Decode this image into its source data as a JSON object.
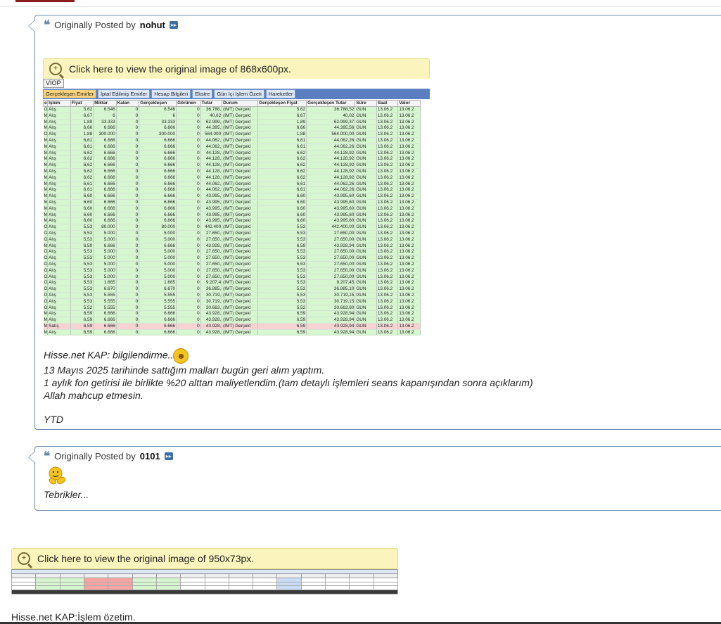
{
  "post1": {
    "quote_prefix": "Originally Posted by",
    "author": "nohut",
    "image_link": "Click here to view the original image of 868x600px.",
    "screenshot": {
      "viop_tab": "VİOP",
      "tabs": [
        "Gerçekleşen Emirler",
        "İptal Edilmiş Emirler",
        "Hesap Bilgileri",
        "Ekstre",
        "Gün İçi İşlem Özeti",
        "Hareketler"
      ],
      "columns": [
        "e",
        "İşlem",
        "Fiyat",
        "Miktar",
        "Kalan",
        "Gerçekleşen",
        "Görünen",
        "Tutar",
        "Durum",
        "Gerçekleşen Fiyat",
        "Gerçekleşen Tutar",
        "Süre",
        "Saat",
        "Valor"
      ],
      "rows": [
        [
          "O",
          "Alış",
          "5,62",
          "6.546",
          "0",
          "6.546",
          "0",
          "36.788,",
          "(İMT) Gerçekl",
          "5,62",
          "36.788,52",
          "GUN",
          "13.06.2",
          "13.06.2"
        ],
        [
          "M",
          "Alış",
          "6,67",
          "6",
          "0",
          "6",
          "0",
          "40,02",
          "(İMT) Gerçekl",
          "6,67",
          "40,02",
          "GUN",
          "13.06.2",
          "13.06.2"
        ],
        [
          "M",
          "Alış",
          "1,89",
          "33.333",
          "0",
          "33.333",
          "0",
          "62.999,",
          "(İMT) Gerçekl",
          "1,89",
          "62.999,37",
          "GUN",
          "13.06.2",
          "13.06.2"
        ],
        [
          "M",
          "Alış",
          "6,66",
          "6.666",
          "0",
          "6.666",
          "0",
          "44.395,",
          "(İMT) Gerçekl",
          "6,66",
          "44.395,56",
          "GUN",
          "13.06.2",
          "13.06.2"
        ],
        [
          "O",
          "Alış",
          "1,88",
          "300.000",
          "0",
          "300.000",
          "0",
          "564.000",
          "(İMT) Gerçekl",
          "1,88",
          "564.000,00",
          "GUN",
          "13.06.2",
          "13.06.2"
        ],
        [
          "M",
          "Alış",
          "6,61",
          "6.666",
          "0",
          "6.666",
          "0",
          "44.062,",
          "(İMT) Gerçekl",
          "6,61",
          "44.062,26",
          "GUN",
          "13.06.2",
          "13.06.2"
        ],
        [
          "M",
          "Alış",
          "6,61",
          "6.666",
          "0",
          "6.666",
          "0",
          "44.062,",
          "(İMT) Gerçekl",
          "6,61",
          "44.062,26",
          "GUN",
          "13.06.2",
          "13.06.2"
        ],
        [
          "M",
          "Alış",
          "6,62",
          "6.666",
          "0",
          "6.666",
          "0",
          "44.128,",
          "(İMT) Gerçekl",
          "6,62",
          "44.128,92",
          "GUN",
          "13.06.2",
          "13.06.2"
        ],
        [
          "M",
          "Alış",
          "6,62",
          "6.666",
          "0",
          "6.666",
          "0",
          "44.128,",
          "(İMT) Gerçekl",
          "6,62",
          "44.128,92",
          "GUN",
          "13.06.2",
          "13.06.2"
        ],
        [
          "M",
          "Alış",
          "6,62",
          "6.666",
          "0",
          "6.666",
          "0",
          "44.128,",
          "(İMT) Gerçekl",
          "6,62",
          "44.128,92",
          "GUN",
          "13.06.2",
          "13.06.2"
        ],
        [
          "M",
          "Alış",
          "6,62",
          "6.666",
          "0",
          "6.666",
          "0",
          "44.128,",
          "(İMT) Gerçekl",
          "6,62",
          "44.128,92",
          "GUN",
          "13.06.2",
          "13.06.2"
        ],
        [
          "M",
          "Alış",
          "6,62",
          "6.666",
          "0",
          "6.666",
          "0",
          "44.128,",
          "(İMT) Gerçekl",
          "6,62",
          "44.128,92",
          "GUN",
          "13.06.2",
          "13.06.2"
        ],
        [
          "M",
          "Alış",
          "6,61",
          "6.666",
          "0",
          "6.666",
          "0",
          "44.062,",
          "(İMT) Gerçekl",
          "6,61",
          "44.062,26",
          "GUN",
          "13.06.2",
          "13.06.2"
        ],
        [
          "M",
          "Alış",
          "6,61",
          "6.666",
          "0",
          "6.666",
          "0",
          "44.062,",
          "(İMT) Gerçekl",
          "6,61",
          "44.062,26",
          "GUN",
          "13.06.2",
          "13.06.2"
        ],
        [
          "M",
          "Alış",
          "6,60",
          "6.666",
          "0",
          "6.666",
          "0",
          "43.995,",
          "(İMT) Gerçekl",
          "6,60",
          "43.995,60",
          "GUN",
          "13.06.2",
          "13.06.2"
        ],
        [
          "M",
          "Alış",
          "6,60",
          "6.666",
          "0",
          "6.666",
          "0",
          "43.995,",
          "(İMT) Gerçekl",
          "6,60",
          "43.995,60",
          "GUN",
          "13.06.2",
          "13.06.2"
        ],
        [
          "M",
          "Alış",
          "6,60",
          "6.666",
          "0",
          "6.666",
          "0",
          "43.995,",
          "(İMT) Gerçekl",
          "6,60",
          "43.995,60",
          "GUN",
          "13.06.2",
          "13.06.2"
        ],
        [
          "M",
          "Alış",
          "6,60",
          "6.666",
          "0",
          "6.666",
          "0",
          "43.995,",
          "(İMT) Gerçekl",
          "6,60",
          "43.995,60",
          "GUN",
          "13.06.2",
          "13.06.2"
        ],
        [
          "M",
          "Alış",
          "6,60",
          "6.666",
          "0",
          "6.666",
          "0",
          "43.995,",
          "(İMT) Gerçekl",
          "6,60",
          "43.995,60",
          "GUN",
          "13.06.2",
          "13.06.2"
        ],
        [
          "O",
          "Alış",
          "5,53",
          "80.000",
          "0",
          "80.000",
          "0",
          "442.400",
          "(İMT) Gerçekl",
          "5,53",
          "442.400,00",
          "GUN",
          "13.06.2",
          "13.06.2"
        ],
        [
          "O",
          "Alış",
          "5,53",
          "5.000",
          "0",
          "5.000",
          "0",
          "27.650,",
          "(İMT) Gerçekl",
          "5,53",
          "27.650,00",
          "GUN",
          "13.06.2",
          "13.06.2"
        ],
        [
          "O",
          "Alış",
          "5,53",
          "5.000",
          "0",
          "5.000",
          "0",
          "27.650,",
          "(İMT) Gerçekl",
          "5,53",
          "27.650,00",
          "GUN",
          "13.06.2",
          "13.06.2"
        ],
        [
          "M",
          "Alış",
          "6,59",
          "6.666",
          "0",
          "6.666",
          "0",
          "43.928,",
          "(İMT) Gerçekl",
          "6,59",
          "43.928,94",
          "GUN",
          "13.06.2",
          "13.06.2"
        ],
        [
          "O",
          "Alış",
          "5,53",
          "5.000",
          "0",
          "5.000",
          "0",
          "27.650,",
          "(İMT) Gerçekl",
          "5,53",
          "27.650,00",
          "GUN",
          "13.06.2",
          "13.06.2"
        ],
        [
          "O",
          "Alış",
          "5,53",
          "5.000",
          "0",
          "5.000",
          "0",
          "27.650,",
          "(İMT) Gerçekl",
          "5,53",
          "27.650,00",
          "GUN",
          "13.06.2",
          "13.06.2"
        ],
        [
          "O",
          "Alış",
          "5,53",
          "5.000",
          "0",
          "5.000",
          "0",
          "27.650,",
          "(İMT) Gerçekl",
          "5,53",
          "27.650,00",
          "GUN",
          "13.06.2",
          "13.06.2"
        ],
        [
          "O",
          "Alış",
          "5,53",
          "5.000",
          "0",
          "5.000",
          "0",
          "27.650,",
          "(İMT) Gerçekl",
          "5,53",
          "27.650,00",
          "GUN",
          "13.06.2",
          "13.06.2"
        ],
        [
          "O",
          "Alış",
          "5,53",
          "5.000",
          "0",
          "5.000",
          "0",
          "27.650,",
          "(İMT) Gerçekl",
          "5,53",
          "27.650,00",
          "GUN",
          "13.06.2",
          "13.06.2"
        ],
        [
          "O",
          "Alış",
          "5,53",
          "1.665",
          "0",
          "1.665",
          "0",
          "9.207,4",
          "(İMT) Gerçekl",
          "5,53",
          "9.207,45",
          "GUN",
          "13.06.2",
          "13.06.2"
        ],
        [
          "O",
          "Alış",
          "5,53",
          "6.670",
          "0",
          "6.670",
          "0",
          "36.885,",
          "(İMT) Gerçekl",
          "5,53",
          "36.885,10",
          "GUN",
          "13.06.2",
          "13.06.2"
        ],
        [
          "O",
          "Alış",
          "5,53",
          "5.555",
          "0",
          "5.555",
          "0",
          "30.719,",
          "(İMT) Gerçekl",
          "5,53",
          "30.719,15",
          "GUN",
          "13.06.2",
          "13.06.2"
        ],
        [
          "O",
          "Alış",
          "5,53",
          "5.555",
          "0",
          "5.555",
          "0",
          "30.719,",
          "(İMT) Gerçekl",
          "5,53",
          "30.719,15",
          "GUN",
          "13.06.2",
          "13.06.2"
        ],
        [
          "O",
          "Alış",
          "5,52",
          "5.555",
          "0",
          "5.555",
          "0",
          "30.663,",
          "(İMT) Gerçekl",
          "5,52",
          "30.663,60",
          "GUN",
          "13.06.2",
          "13.06.2"
        ],
        [
          "M",
          "Alış",
          "6,59",
          "6.666",
          "0",
          "6.666",
          "0",
          "43.928,",
          "(İMT) Gerçekl",
          "6,59",
          "43.928,94",
          "GUN",
          "13.06.2",
          "13.06.2"
        ],
        [
          "M",
          "Alış",
          "6,59",
          "6.666",
          "0",
          "6.666",
          "0",
          "43.928,",
          "(İMT) Gerçekl",
          "6,59",
          "43.928,94",
          "GUN",
          "13.06.2",
          "13.06.2"
        ],
        [
          "M",
          "Satış",
          "6,59",
          "6.666",
          "0",
          "6.666",
          "0",
          "43.928,",
          "(İMT) Gerçekl",
          "6,59",
          "43.928,94",
          "GUN",
          "13.06.2",
          "13.06.2"
        ],
        [
          "M",
          "Alış",
          "6,59",
          "6.666",
          "0",
          "6.666",
          "0",
          "43.928,",
          "(İMT) Gerçekl",
          "6,59",
          "43.928,94",
          "GUN",
          "13.06.2",
          "13.06.2"
        ]
      ]
    },
    "text_lines": [
      "Hisse.net KAP: bilgilendirme..",
      "13 Mayıs 2025 tarihinde sattığım malları bugün geri alım yaptım.",
      "1 aylık fon getirisi ile birlikte %20 alttan maliyetlendim.(tam detaylı işlemleri seans kapanışından sonra açıklarım)",
      "Allah mahcup etmesin.",
      "",
      "YTD"
    ]
  },
  "post2": {
    "quote_prefix": "Originally Posted by",
    "author": "0101",
    "text": "Tebrikler..."
  },
  "reply": {
    "image_link": "Click here to view the original image of 950x73px.",
    "caption": "Hisse.net KAP:İşlem özetim."
  },
  "colors": {
    "quote_border": "#6d8ca9",
    "image_bar_bg": "#fbf5bd",
    "buy_row": "#d6f6d0",
    "sell_row": "#f6d3d3",
    "tab_bar": "#5a7ec0"
  },
  "icons": [
    "quote-icon",
    "go-to-post-icon",
    "magnifier-icon",
    "smiley-icon",
    "clapping-icon"
  ]
}
